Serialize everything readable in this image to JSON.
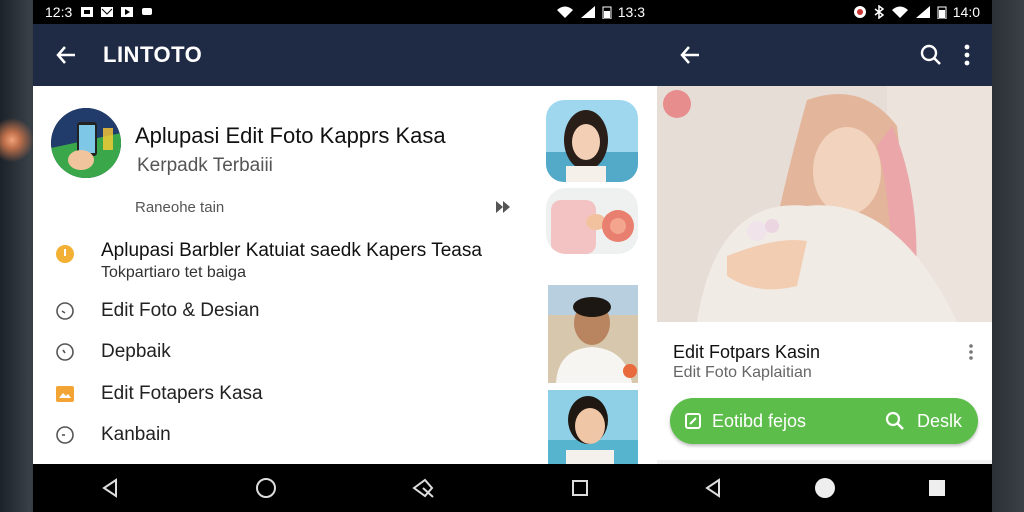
{
  "left_phone": {
    "status": {
      "time": "12:3",
      "battery_text": "13:3"
    },
    "app_title": "LINTOTO",
    "header": {
      "title": "Aplupasi Edit Foto Kapprs Kasa",
      "subtitle": "Kerpadk Terbaiii",
      "caption": "Raneohe tain"
    },
    "items": [
      {
        "title": "Aplupasi Barbler Katuiat  saedk Kapers Teasa",
        "subtitle": "Tokpartiaro tet baiga"
      },
      {
        "title": "Edit Foto & Desian"
      },
      {
        "title": "Depbaik"
      },
      {
        "title": "Edit Fotapers Kasa"
      },
      {
        "title": "Kanbain"
      }
    ]
  },
  "right_phone": {
    "status": {
      "time": "14:0"
    },
    "card": {
      "title": "Edit Fotpars Kasin",
      "subtitle": "Edit Foto Kaplaitian",
      "edit_button": "Eotibd fejos",
      "search_button": "Deslk"
    }
  }
}
